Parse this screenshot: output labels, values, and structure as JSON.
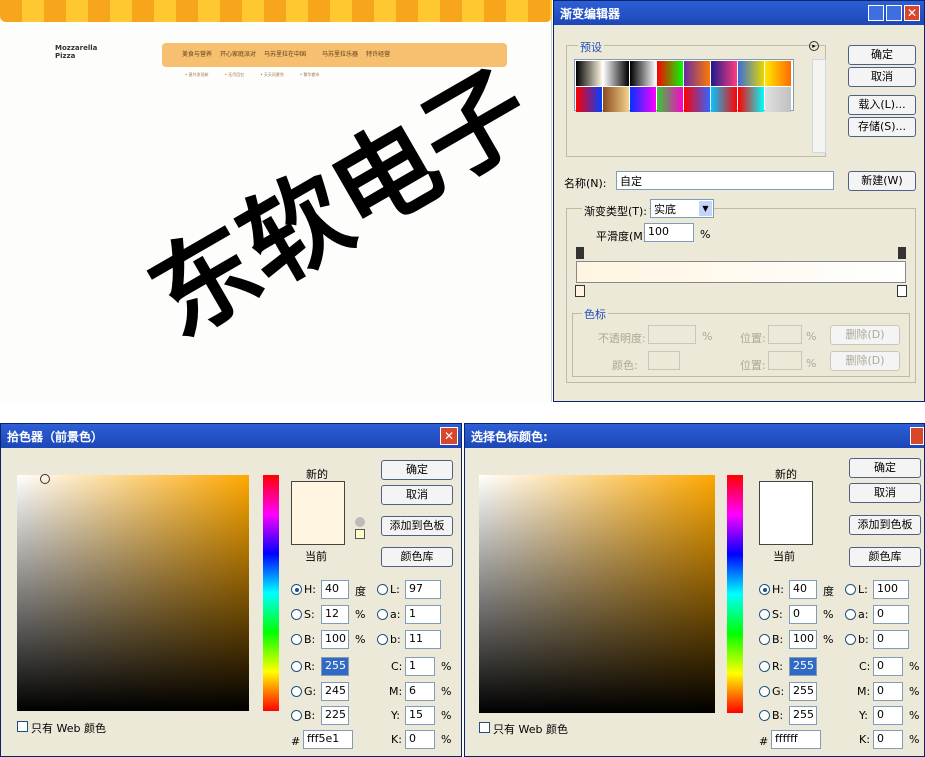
{
  "web": {
    "brand": "Mozzarella Pizza",
    "nav": [
      "美食与营养",
      "开心家庭派对",
      "马苏里拉在中国",
      "",
      "马苏里拉乐器",
      "特许经营"
    ],
    "subnav": [
      "• 意外发现新",
      "• 无尽回忆",
      "• 天天风景秀",
      "• 繁华都市"
    ]
  },
  "grad": {
    "title": "渐变编辑器",
    "presets_label": "预设",
    "ok": "确定",
    "cancel": "取消",
    "load": "载入(L)...",
    "save": "存储(S)...",
    "name_label": "名称(N):",
    "name_value": "自定",
    "new": "新建(W)",
    "type_label": "渐变类型(T):",
    "type_value": "实底",
    "smooth_label": "平滑度(M):",
    "smooth_value": "100",
    "pct": "%",
    "stops_label": "色标",
    "opacity_label": "不透明度:",
    "color_label": "颜色:",
    "loc_label": "位置:",
    "delete": "删除(D)",
    "presets": [
      [
        "#000000",
        "#fff5e1"
      ],
      [
        "#ffffff",
        "#000000"
      ],
      [
        "#000000",
        "#ffffff"
      ],
      [
        "#ff0000",
        "#00ff00"
      ],
      [
        "#6a2aa6",
        "#ff7a00"
      ],
      [
        "#1e1b8c",
        "#ff3c7f"
      ],
      [
        "#3a6ed8",
        "#e6d800"
      ],
      [
        "#ffe800",
        "#ff6a00"
      ],
      [
        "#ff0000",
        "#0040ff"
      ],
      [
        "#8a4b1f",
        "#f4d38a"
      ],
      [
        "#0033ff",
        "#ff00ff"
      ],
      [
        "#33cc33",
        "#ff00cc"
      ],
      [
        "#ff0000",
        "#3366ff"
      ],
      [
        "#00c8ff",
        "#ff0000"
      ],
      [
        "#ff0000",
        "#00ffff"
      ],
      [
        "#e0e0e0",
        "#c0c0c0"
      ]
    ]
  },
  "picker1": {
    "title": "拾色器（前景色）",
    "new_label": "新的",
    "current_label": "当前",
    "ok": "确定",
    "cancel": "取消",
    "add": "添加到色板",
    "lib": "颜色库",
    "web_only": "只有 Web 颜色",
    "new_color": "#fff5e1",
    "current_color": "#fff5e1",
    "H": "40",
    "S": "12",
    "B": "100",
    "L": "97",
    "a": "1",
    "b": "11",
    "R": "255",
    "G": "245",
    "Bv": "225",
    "C": "1",
    "M": "6",
    "Y": "15",
    "K": "0",
    "hex": "fff5e1",
    "deg": "度",
    "pct": "%",
    "hue_color": "#ffa800"
  },
  "picker2": {
    "title": "选择色标颜色:",
    "new_label": "新的",
    "current_label": "当前",
    "ok": "确定",
    "cancel": "取消",
    "add": "添加到色板",
    "lib": "颜色库",
    "web_only": "只有 Web 颜色",
    "new_color": "#ffffff",
    "current_color": "#ffffff",
    "H": "40",
    "S": "0",
    "B": "100",
    "L": "100",
    "a": "0",
    "b": "0",
    "R": "255",
    "G": "255",
    "Bv": "255",
    "C": "0",
    "M": "0",
    "Y": "0",
    "K": "0",
    "hex": "ffffff",
    "deg": "度",
    "pct": "%",
    "hue_color": "#ffa800"
  },
  "watermark": "东软电子"
}
